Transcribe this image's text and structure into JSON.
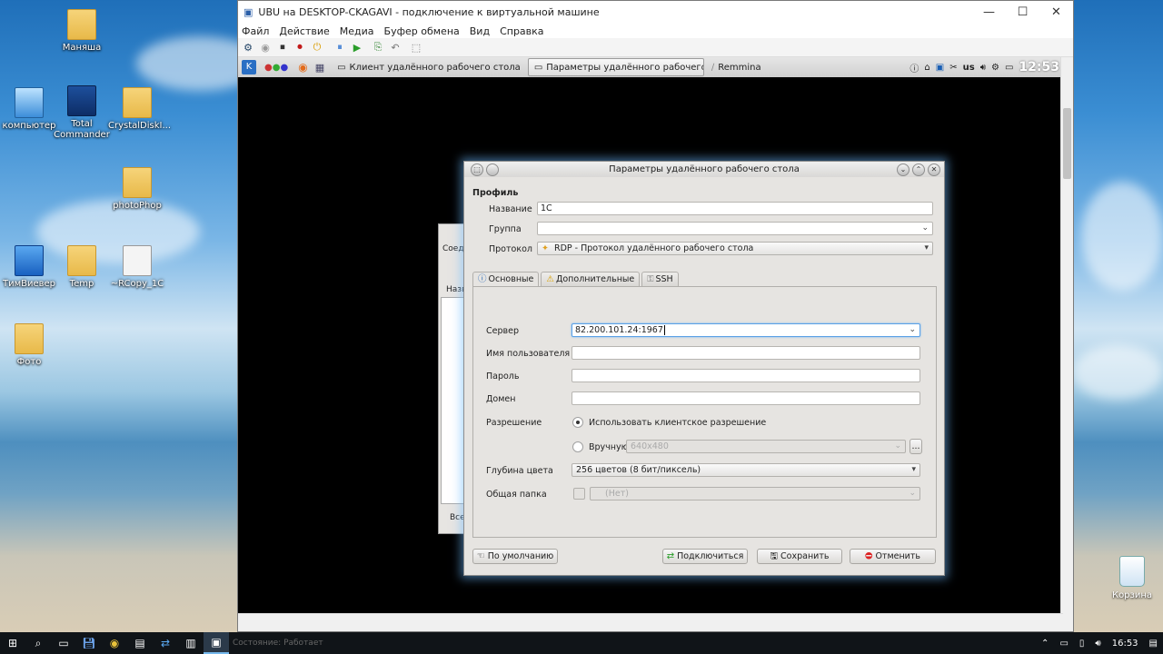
{
  "desktop": {
    "icons": [
      {
        "label": "Маняша",
        "kind": "folder"
      },
      {
        "label": "компьютер",
        "kind": "pc"
      },
      {
        "label": "Total Commander",
        "kind": "drive"
      },
      {
        "label": "CrystalDiskI...",
        "kind": "folder"
      },
      {
        "label": "photoPhop",
        "kind": "folder"
      },
      {
        "label": "ТимВиевер",
        "kind": "tv"
      },
      {
        "label": "Temp",
        "kind": "folder"
      },
      {
        "label": "~RCopy_1C",
        "kind": "file"
      },
      {
        "label": "Фото",
        "kind": "folder"
      }
    ],
    "recycle_label": "Корзина"
  },
  "vm_window": {
    "title": "UBU на DESKTOP-CKAGAVI - подключение к виртуальной машине",
    "menu": [
      "Файл",
      "Действие",
      "Медиа",
      "Буфер обмена",
      "Вид",
      "Справка"
    ],
    "controls": {
      "minimize": "—",
      "maximize": "☐",
      "close": "✕"
    }
  },
  "kde_panel": {
    "tasks": [
      {
        "label": "Клиент удалённого рабочего стола",
        "active": false
      },
      {
        "label": "Параметры удалённого рабочего ст",
        "active": true
      },
      {
        "label": "Remmina",
        "active": false
      }
    ],
    "layout": "us",
    "clock": "12:53"
  },
  "background_dialog": {
    "label_1": "Соед",
    "label_2": "Назв",
    "label_3": "Все"
  },
  "dialog": {
    "title": "Параметры удалённого рабочего стола",
    "profile_header": "Профиль",
    "name_label": "Название",
    "name_value": "1С",
    "group_label": "Группа",
    "group_value": "",
    "protocol_label": "Протокол",
    "protocol_value": "RDP - Протокол удалённого рабочего стола",
    "tabs": [
      "Основные",
      "Дополнительные",
      "SSH"
    ],
    "server_label": "Сервер",
    "server_value": "82.200.101.24:1967",
    "user_label": "Имя пользователя",
    "password_label": "Пароль",
    "domain_label": "Домен",
    "resolution_label": "Разрешение",
    "resolution_client": "Использовать клиентское разрешение",
    "resolution_manual": "Вручную",
    "resolution_manual_value": "640x480",
    "ellipsis": "...",
    "color_depth_label": "Глубина цвета",
    "color_depth_value": "256 цветов (8 бит/пиксель)",
    "shared_folder_label": "Общая папка",
    "shared_folder_value": "(Нет)",
    "btn_default": "По умолчанию",
    "btn_connect": "Подключиться",
    "btn_save": "Сохранить",
    "btn_cancel": "Отменить"
  },
  "vm_status": "Состояние: Работает",
  "win_taskbar": {
    "time": "16:53"
  }
}
